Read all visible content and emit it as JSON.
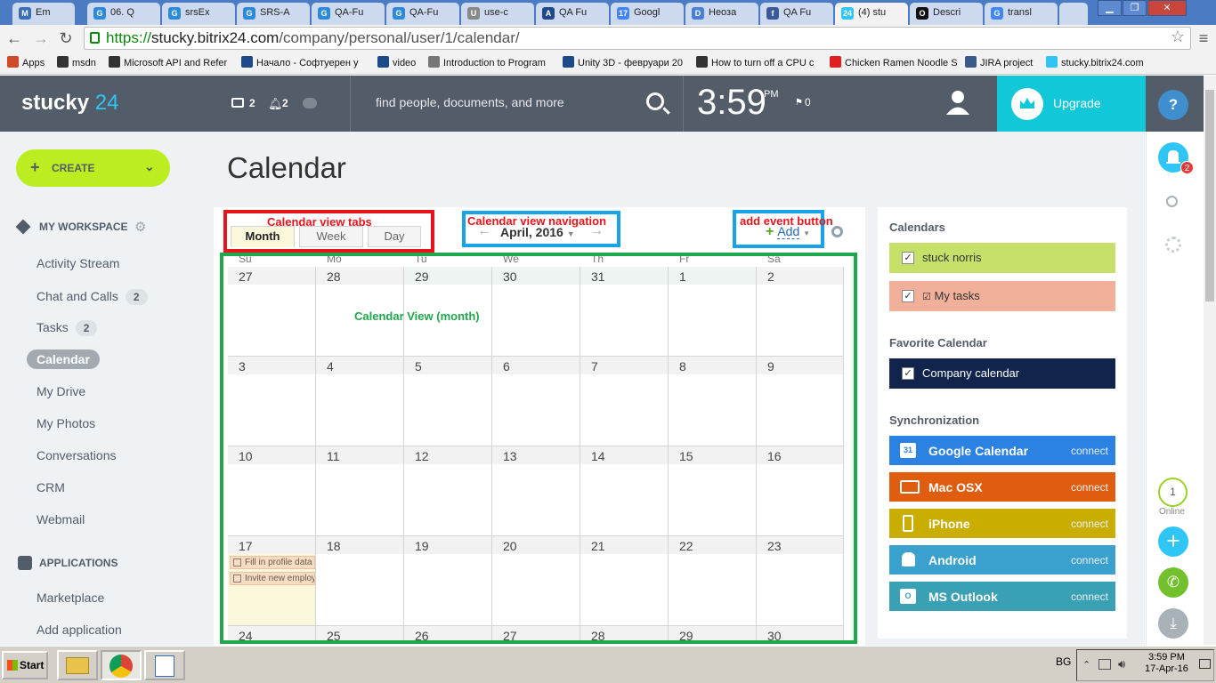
{
  "browser": {
    "tabs": [
      {
        "label": "Em",
        "fav": "M"
      },
      {
        "label": "06. Q",
        "fav": "G"
      },
      {
        "label": "srsEx",
        "fav": "G"
      },
      {
        "label": "SRS-A",
        "fav": "G"
      },
      {
        "label": "QA-Fu",
        "fav": "G"
      },
      {
        "label": "QA-Fu",
        "fav": "G"
      },
      {
        "label": "use-c",
        "fav": "U"
      },
      {
        "label": "QA Fu",
        "fav": "A"
      },
      {
        "label": "Googl",
        "fav": "17"
      },
      {
        "label": "Неозa",
        "fav": "D"
      },
      {
        "label": "QA Fu",
        "fav": "f"
      },
      {
        "label": "(4) stu",
        "fav": "24"
      },
      {
        "label": "Descri",
        "fav": "O"
      },
      {
        "label": "transl",
        "fav": "G"
      }
    ],
    "url_scheme": "https://",
    "url_host": "stucky.bitrix24.com",
    "url_path": "/company/personal/user/1/calendar/",
    "bookmarks": [
      "Apps",
      "msdn",
      "Microsoft API and Refer",
      "Начало - Софтуерен у",
      "video",
      "Introduction to Program",
      "Unity 3D - февруари 20",
      "How to turn off a CPU c",
      "Chicken Ramen Noodle S",
      "JIRA project",
      "stucky.bitrix24.com"
    ]
  },
  "header": {
    "logo_text": "stucky",
    "logo_num": "24",
    "chat_count": "2",
    "notif_count": "2",
    "search_placeholder": "find people, documents, and more",
    "clock": "3:59",
    "ampm": "PM",
    "flag_count": "0",
    "upgrade_label": "Upgrade",
    "help_label": "?"
  },
  "sidebar": {
    "create_label": "CREATE",
    "workspace_title": "MY WORKSPACE",
    "items": [
      {
        "label": "Activity Stream",
        "badge": ""
      },
      {
        "label": "Chat and Calls",
        "badge": "2"
      },
      {
        "label": "Tasks",
        "badge": "2"
      },
      {
        "label": "Calendar",
        "badge": ""
      },
      {
        "label": "My Drive",
        "badge": ""
      },
      {
        "label": "My Photos",
        "badge": ""
      },
      {
        "label": "Conversations",
        "badge": ""
      },
      {
        "label": "CRM",
        "badge": ""
      },
      {
        "label": "Webmail",
        "badge": ""
      }
    ],
    "applications_title": "APPLICATIONS",
    "app_items": [
      "Marketplace",
      "Add application"
    ]
  },
  "page": {
    "title": "Calendar",
    "view_tabs": [
      "Month",
      "Week",
      "Day"
    ],
    "month_label": "April, 2016",
    "add_label": "Add",
    "annotations": {
      "tabs": "Calendar view tabs",
      "nav": "Calendar view navigation",
      "add": "add event button",
      "view": "Calendar View (month)"
    },
    "colors": {
      "annotation_red": "#e8141c",
      "annotation_blue": "#17a3e6",
      "annotation_green": "#1fa84b"
    }
  },
  "calendar": {
    "day_names": [
      "Su",
      "Mo",
      "Tu",
      "We",
      "Th",
      "Fr",
      "Sa"
    ],
    "weeks": [
      [
        "27",
        "28",
        "29",
        "30",
        "31",
        "1",
        "2"
      ],
      [
        "3",
        "4",
        "5",
        "6",
        "7",
        "8",
        "9"
      ],
      [
        "10",
        "11",
        "12",
        "13",
        "14",
        "15",
        "16"
      ],
      [
        "17",
        "18",
        "19",
        "20",
        "21",
        "22",
        "23"
      ],
      [
        "24",
        "25",
        "26",
        "27",
        "28",
        "29",
        "30"
      ]
    ],
    "events": [
      "Fill in profile data",
      "Invite new employ"
    ]
  },
  "right_panel": {
    "calendars_title": "Calendars",
    "calendars": [
      {
        "label": "stuck norris",
        "color": "#c6e06a"
      },
      {
        "label": "My tasks",
        "color": "#f2b09a"
      }
    ],
    "favorite_title": "Favorite Calendar",
    "favorite": {
      "label": "Company calendar",
      "color": "#10244c"
    },
    "sync_title": "Synchronization",
    "sync": [
      {
        "label": "Google Calendar",
        "action": "connect",
        "color": "#2b82e3",
        "icon": "31"
      },
      {
        "label": "Mac OSX",
        "action": "connect",
        "color": "#e05c0f",
        "icon": ""
      },
      {
        "label": "iPhone",
        "action": "connect",
        "color": "#c9ad00",
        "icon": ""
      },
      {
        "label": "Android",
        "action": "connect",
        "color": "#3aa0cd",
        "icon": ""
      },
      {
        "label": "MS Outlook",
        "action": "connect",
        "color": "#3aa0b4",
        "icon": "O"
      }
    ]
  },
  "farright": {
    "notif_badge": "2",
    "online_count": "1",
    "online_label": "Online"
  },
  "taskbar": {
    "start_label": "Start",
    "lang": "BG",
    "time": "3:59 PM",
    "date": "17-Apr-16"
  }
}
